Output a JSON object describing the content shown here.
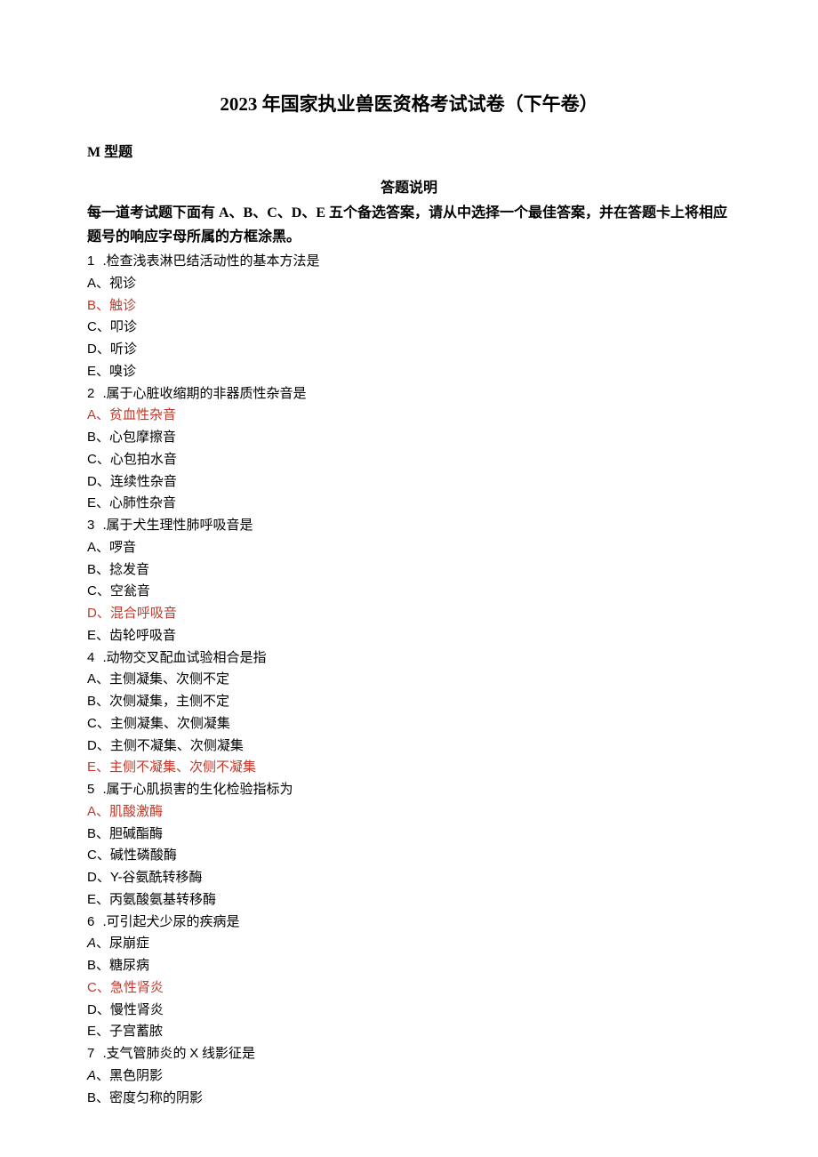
{
  "title": "2023 年国家执业兽医资格考试试卷（下午卷）",
  "section": "M 型题",
  "explain_header": "答题说明",
  "instructions": "每一道考试题下面有 A、B、C、D、E 五个备选答案，请从中选择一个最佳答案，并在答题卡上将相应题号的响应字母所属的方框涂黑。",
  "highlight_color": "#c0392b",
  "questions": [
    {
      "n": "1",
      "stem": ".检查浅表淋巴结活动性的基本方法是",
      "opts": [
        {
          "l": "A",
          "t": "视诊"
        },
        {
          "l": "B",
          "t": "触诊",
          "hl": true
        },
        {
          "l": "C",
          "t": "叩诊"
        },
        {
          "l": "D",
          "t": "听诊"
        },
        {
          "l": "E",
          "t": "嗅诊"
        }
      ]
    },
    {
      "n": "2",
      "stem": ".属于心脏收缩期的非器质性杂音是",
      "opts": [
        {
          "l": "A",
          "t": "贫血性杂音",
          "hl": true
        },
        {
          "l": "B",
          "t": "心包摩擦音"
        },
        {
          "l": "C",
          "t": "心包拍水音"
        },
        {
          "l": "D",
          "t": "连续性杂音"
        },
        {
          "l": "E",
          "t": "心肺性杂音"
        }
      ]
    },
    {
      "n": "3",
      "stem": ".属于犬生理性肺呼吸音是",
      "opts": [
        {
          "l": "A",
          "t": "啰音"
        },
        {
          "l": "B",
          "t": "捻发音"
        },
        {
          "l": "C",
          "t": "空瓮音"
        },
        {
          "l": "D",
          "t": "混合呼吸音",
          "hl": true
        },
        {
          "l": "E",
          "t": "齿轮呼吸音"
        }
      ]
    },
    {
      "n": "4",
      "stem": ".动物交叉配血试验相合是指",
      "opts": [
        {
          "l": "A",
          "t": "主侧凝集、次侧不定"
        },
        {
          "l": "B",
          "t": "次侧凝集，主侧不定"
        },
        {
          "l": "C",
          "t": "主侧凝集、次侧凝集"
        },
        {
          "l": "D",
          "t": "主侧不凝集、次侧凝集"
        },
        {
          "l": "E",
          "t": "主侧不凝集、次侧不凝集",
          "hl": true
        }
      ]
    },
    {
      "n": "5",
      "stem": ".属于心肌损害的生化检验指标为",
      "opts": [
        {
          "l": "A",
          "t": "肌酸激酶",
          "hl": true
        },
        {
          "l": "B",
          "t": "胆碱酯酶"
        },
        {
          "l": "C",
          "t": "碱性磷酸酶"
        },
        {
          "l": "D",
          "t": "Y-谷氨酰转移酶"
        },
        {
          "l": "E",
          "t": "丙氨酸氨基转移酶"
        }
      ]
    },
    {
      "n": "6",
      "stem": ".可引起犬少尿的疾病是",
      "stem_italic_first": true,
      "opts": [
        {
          "l": "A",
          "t": "尿崩症",
          "it": true
        },
        {
          "l": "B",
          "t": "糖尿病"
        },
        {
          "l": "C",
          "t": "急性肾炎",
          "hl": true
        },
        {
          "l": "D",
          "t": "慢性肾炎"
        },
        {
          "l": "E",
          "t": "子宫蓄脓"
        }
      ]
    },
    {
      "n": "7",
      "stem": ".支气管肺炎的 X 线影征是",
      "opts": [
        {
          "l": "A",
          "t": "黑色阴影",
          "it": true
        },
        {
          "l": "B",
          "t": "密度匀称的阴影"
        }
      ]
    }
  ]
}
